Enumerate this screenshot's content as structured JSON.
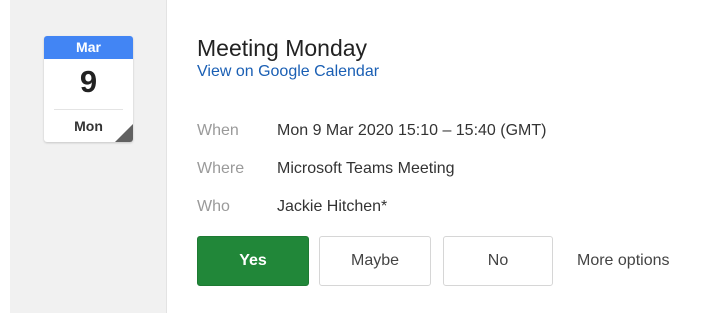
{
  "calendar": {
    "month": "Mar",
    "day": "9",
    "weekday": "Mon"
  },
  "event": {
    "title": "Meeting Monday",
    "link": "View on Google Calendar"
  },
  "details": {
    "when": {
      "label": "When",
      "value": "Mon 9 Mar 2020 15:10 – 15:40 (GMT)"
    },
    "where": {
      "label": "Where",
      "value": "Microsoft Teams Meeting"
    },
    "who": {
      "label": "Who",
      "value": "Jackie Hitchen*"
    }
  },
  "rsvp": {
    "yes": "Yes",
    "maybe": "Maybe",
    "no": "No",
    "more": "More options"
  },
  "colors": {
    "month_header": "#4285f4",
    "yes_button": "#218739",
    "link": "#1a5fb4"
  }
}
